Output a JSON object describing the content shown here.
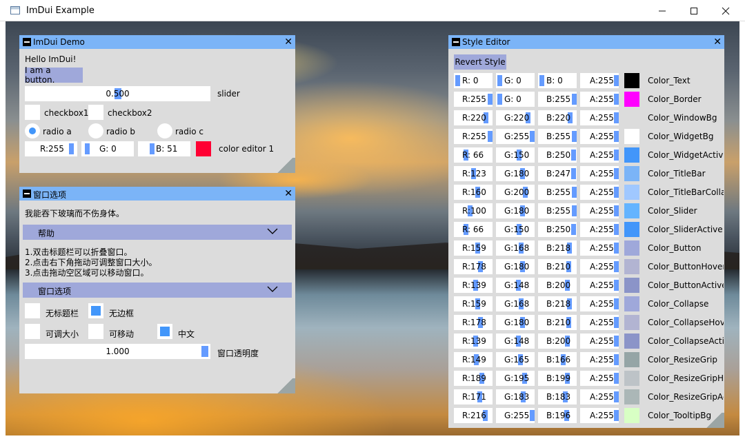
{
  "app": {
    "title": "ImDui Example"
  },
  "demo": {
    "title": "ImDui Demo",
    "hello": "Hello ImDui!",
    "button": "I am a button.",
    "slider_value": "0.500",
    "slider_fraction": 0.5,
    "slider_label": "slider",
    "checkbox1": "checkbox1",
    "checkbox2": "checkbox2",
    "radio_a": "radio a",
    "radio_b": "radio b",
    "radio_c": "radio c",
    "color_r": "R:255",
    "color_g": "G:  0",
    "color_b": "B: 51",
    "color_label": "color editor 1",
    "color_value": "#ff0033"
  },
  "options": {
    "title": "窗口选项",
    "quote": "我能吞下玻璃而不伤身体。",
    "help_header": "帮助",
    "help_lines": [
      "1.双击标题栏可以折叠窗口。",
      "2.点击右下角拖动可调整窗口大小。",
      "3.点击拖动空区域可以移动窗口。"
    ],
    "options_header": "窗口选项",
    "no_titlebar": "无标题栏",
    "no_border": "无边框",
    "resizable": "可调大小",
    "movable": "可移动",
    "chinese": "中文",
    "opacity_value": "1.000",
    "opacity_fraction": 1.0,
    "opacity_label": "窗口透明度"
  },
  "style_editor": {
    "title": "Style Editor",
    "revert": "Revert Style",
    "rows": [
      {
        "r": "R:  0",
        "g": "G:  0",
        "b": "B:  0",
        "a": "A:255",
        "rv": 0,
        "gv": 0,
        "bv": 0,
        "av": 255,
        "color": "#000000",
        "name": "Color_Text"
      },
      {
        "r": "R:255",
        "g": "G:  0",
        "b": "B:255",
        "a": "A:255",
        "rv": 255,
        "gv": 0,
        "bv": 255,
        "av": 255,
        "color": "#ff00ff",
        "name": "Color_Border"
      },
      {
        "r": "R:220",
        "g": "G:220",
        "b": "B:220",
        "a": "A:255",
        "rv": 220,
        "gv": 220,
        "bv": 220,
        "av": 255,
        "color": "#dcdcdc",
        "name": "Color_WindowBg"
      },
      {
        "r": "R:255",
        "g": "G:255",
        "b": "B:255",
        "a": "A:255",
        "rv": 255,
        "gv": 255,
        "bv": 255,
        "av": 255,
        "color": "#ffffff",
        "name": "Color_WidgetBg"
      },
      {
        "r": "R: 66",
        "g": "G:150",
        "b": "B:250",
        "a": "A:255",
        "rv": 66,
        "gv": 150,
        "bv": 250,
        "av": 255,
        "color": "#4296fa",
        "name": "Color_WidgetActive"
      },
      {
        "r": "R:123",
        "g": "G:180",
        "b": "B:247",
        "a": "A:255",
        "rv": 123,
        "gv": 180,
        "bv": 247,
        "av": 255,
        "color": "#7bb4f7",
        "name": "Color_TitleBar"
      },
      {
        "r": "R:160",
        "g": "G:200",
        "b": "B:255",
        "a": "A:255",
        "rv": 160,
        "gv": 200,
        "bv": 255,
        "av": 255,
        "color": "#a0c8ff",
        "name": "Color_TitleBarCollapsed"
      },
      {
        "r": "R:100",
        "g": "G:180",
        "b": "B:255",
        "a": "A:255",
        "rv": 100,
        "gv": 180,
        "bv": 255,
        "av": 255,
        "color": "#64b4ff",
        "name": "Color_Slider"
      },
      {
        "r": "R: 66",
        "g": "G:150",
        "b": "B:250",
        "a": "A:255",
        "rv": 66,
        "gv": 150,
        "bv": 250,
        "av": 255,
        "color": "#4296fa",
        "name": "Color_SliderActive"
      },
      {
        "r": "R:159",
        "g": "G:168",
        "b": "B:218",
        "a": "A:255",
        "rv": 159,
        "gv": 168,
        "bv": 218,
        "av": 255,
        "color": "#9fa8da",
        "name": "Color_Button"
      },
      {
        "r": "R:178",
        "g": "G:180",
        "b": "B:210",
        "a": "A:255",
        "rv": 178,
        "gv": 180,
        "bv": 210,
        "av": 255,
        "color": "#b2b4d2",
        "name": "Color_ButtonHovered"
      },
      {
        "r": "R:139",
        "g": "G:148",
        "b": "B:200",
        "a": "A:255",
        "rv": 139,
        "gv": 148,
        "bv": 200,
        "av": 255,
        "color": "#8b94c8",
        "name": "Color_ButtonActive"
      },
      {
        "r": "R:159",
        "g": "G:168",
        "b": "B:218",
        "a": "A:255",
        "rv": 159,
        "gv": 168,
        "bv": 218,
        "av": 255,
        "color": "#9fa8da",
        "name": "Color_Collapse"
      },
      {
        "r": "R:178",
        "g": "G:180",
        "b": "B:210",
        "a": "A:255",
        "rv": 178,
        "gv": 180,
        "bv": 210,
        "av": 255,
        "color": "#b2b4d2",
        "name": "Color_CollapseHovered"
      },
      {
        "r": "R:139",
        "g": "G:148",
        "b": "B:200",
        "a": "A:255",
        "rv": 139,
        "gv": 148,
        "bv": 200,
        "av": 255,
        "color": "#8b94c8",
        "name": "Color_CollapseActive"
      },
      {
        "r": "R:149",
        "g": "G:165",
        "b": "B:166",
        "a": "A:255",
        "rv": 149,
        "gv": 165,
        "bv": 166,
        "av": 255,
        "color": "#95a5a6",
        "name": "Color_ResizeGrip"
      },
      {
        "r": "R:189",
        "g": "G:195",
        "b": "B:199",
        "a": "A:255",
        "rv": 189,
        "gv": 195,
        "bv": 199,
        "av": 255,
        "color": "#bdc3c7",
        "name": "Color_ResizeGripHovered"
      },
      {
        "r": "R:171",
        "g": "G:183",
        "b": "B:183",
        "a": "A:255",
        "rv": 171,
        "gv": 183,
        "bv": 183,
        "av": 255,
        "color": "#abb7b7",
        "name": "Color_ResizeGripActive"
      },
      {
        "r": "R:216",
        "g": "G:255",
        "b": "B:196",
        "a": "A:255",
        "rv": 216,
        "gv": 255,
        "bv": 196,
        "av": 255,
        "color": "#d8ffc4",
        "name": "Color_TooltipBg"
      }
    ]
  }
}
